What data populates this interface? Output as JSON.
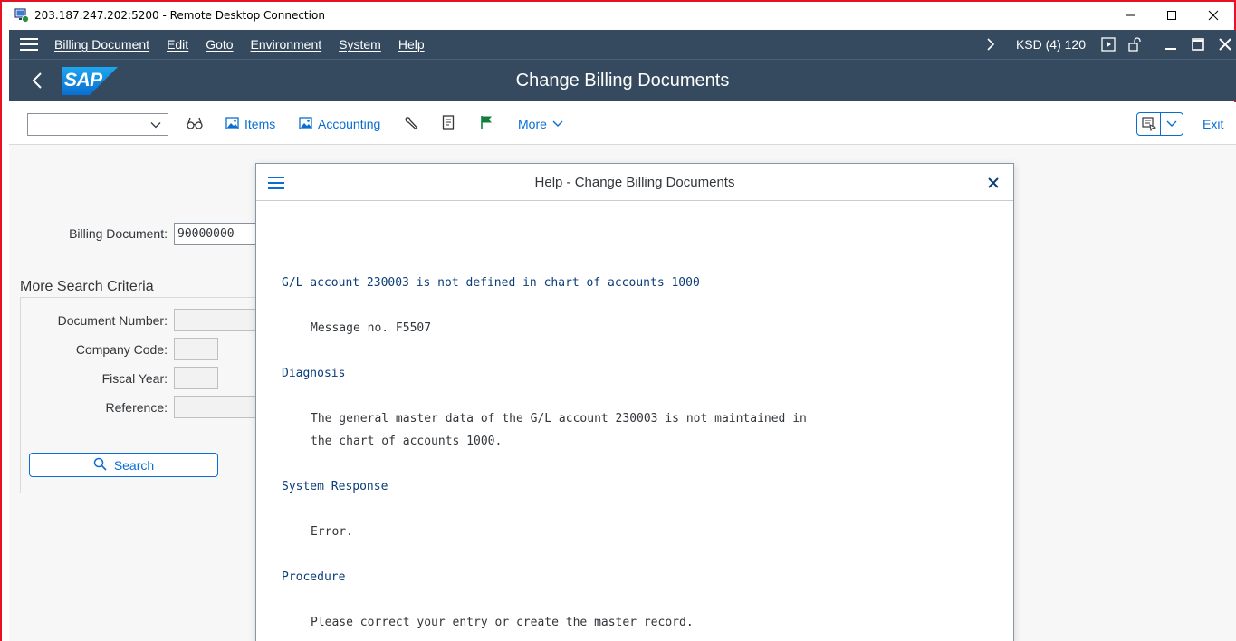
{
  "window": {
    "title": "203.187.247.202:5200 - Remote Desktop Connection",
    "controls": [
      "minimize",
      "maximize",
      "close"
    ]
  },
  "menubar": {
    "items": [
      "Billing Document",
      "Edit",
      "Goto",
      "Environment",
      "System",
      "Help"
    ],
    "system_info": "KSD (4) 120"
  },
  "shell": {
    "logo_text": "SAP",
    "title": "Change Billing Documents"
  },
  "toolbar": {
    "select_value": "",
    "items_label": "Items",
    "accounting_label": "Accounting",
    "more_label": "More",
    "exit_label": "Exit"
  },
  "form": {
    "billing_document_label": "Billing Document:",
    "billing_document_value": "90000000",
    "more_search_title": "More Search Criteria",
    "document_number_label": "Document Number:",
    "company_code_label": "Company Code:",
    "fiscal_year_label": "Fiscal Year:",
    "reference_label": "Reference:",
    "search_label": "Search"
  },
  "dialog": {
    "title": "Help - Change Billing Documents",
    "message": "G/L account 230003 is not defined in chart of accounts 1000",
    "message_no": "Message no. F5507",
    "diagnosis_heading": "Diagnosis",
    "diagnosis_line1": "The general master data of the G/L account 230003 is not maintained in",
    "diagnosis_line2": "the chart of accounts 1000.",
    "system_response_heading": "System Response",
    "system_response_text": "Error.",
    "procedure_heading": "Procedure",
    "procedure_text": "Please correct your entry or create the master record."
  },
  "colors": {
    "shell_bg": "#354a5f",
    "accent": "#0a6ed1",
    "frame_border": "#e81123",
    "help_heading": "#0b3d78"
  }
}
